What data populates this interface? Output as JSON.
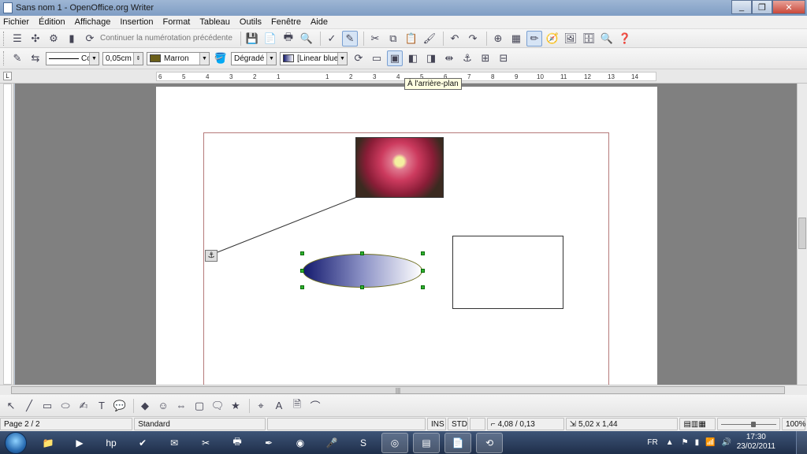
{
  "window": {
    "title": "Sans nom 1 - OpenOffice.org Writer"
  },
  "menu": [
    "Fichier",
    "Édition",
    "Affichage",
    "Insertion",
    "Format",
    "Tableau",
    "Outils",
    "Fenêtre",
    "Aide"
  ],
  "toolbar1": {
    "continue_numbering": "Continuer la numérotation précédente"
  },
  "toolbar2": {
    "line_style_value": "Co",
    "line_width": "0,05cm",
    "line_color": "Marron",
    "line_color_hex": "#6b5f1a",
    "area_style": "Dégradé",
    "gradient_name": "[Linear blue",
    "tooltip": "À l'arrière-plan"
  },
  "ruler": {
    "labels": [
      "6",
      "5",
      "4",
      "3",
      "2",
      "1",
      "1",
      "2",
      "3",
      "4",
      "5",
      "6",
      "7",
      "8",
      "9",
      "10",
      "11",
      "12",
      "13",
      "14"
    ]
  },
  "statusbar": {
    "page": "Page 2 / 2",
    "style": "Standard",
    "ins": "INS",
    "std": "STD",
    "position": "4,08 / 0,13",
    "size": "5,02 x 1,44",
    "zoom": "100%"
  },
  "taskbar": {
    "lang": "FR",
    "time": "17:30",
    "date": "23/02/2011"
  }
}
